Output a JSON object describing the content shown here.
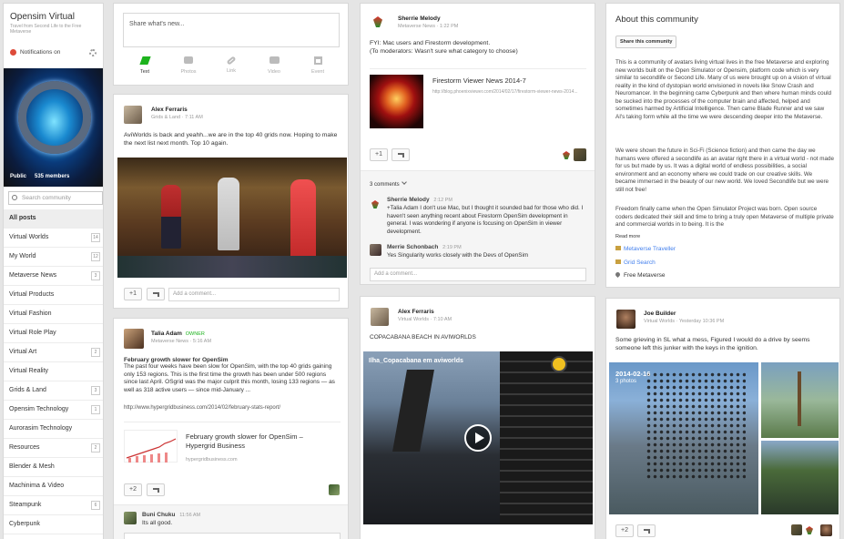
{
  "sidebar": {
    "title": "Opensim Virtual",
    "subtitle": "Travel from Second Life to the Free Metaverse",
    "notifications_label": "Notifications on",
    "visibility": "Public",
    "members": "535 members",
    "search_placeholder": "Search community",
    "items": [
      {
        "label": "All posts",
        "count": ""
      },
      {
        "label": "Virtual Worlds",
        "count": "14"
      },
      {
        "label": "My World",
        "count": "12"
      },
      {
        "label": "Metaverse News",
        "count": "3"
      },
      {
        "label": "Virtual Products",
        "count": ""
      },
      {
        "label": "Virtual Fashion",
        "count": ""
      },
      {
        "label": "Virtual Role Play",
        "count": ""
      },
      {
        "label": "Virtual Art",
        "count": "2"
      },
      {
        "label": "Virtual Reality",
        "count": ""
      },
      {
        "label": "Grids & Land",
        "count": "3"
      },
      {
        "label": "Opensim Technology",
        "count": "1"
      },
      {
        "label": "Aurorasim Technology",
        "count": ""
      },
      {
        "label": "Resources",
        "count": "2"
      },
      {
        "label": "Blender & Mesh",
        "count": ""
      },
      {
        "label": "Machinima & Video",
        "count": ""
      },
      {
        "label": "Steampunk",
        "count": "6"
      },
      {
        "label": "Cyberpunk",
        "count": ""
      }
    ]
  },
  "composer": {
    "placeholder": "Share what's new...",
    "actions": [
      "Text",
      "Photos",
      "Link",
      "Video",
      "Event"
    ]
  },
  "post_alex": {
    "author": "Alex Ferraris",
    "category": "Grids & Land",
    "time": "7:11 AM",
    "text": "AviWorlds is back and yeahh...we are in the top 40 grids now. Hoping to make the next list next month. Top 10 again.",
    "plus": "+1",
    "add_comment": "Add a comment..."
  },
  "post_talia": {
    "author": "Talia Adam",
    "role": "OWNER",
    "category": "Metaverse News",
    "time": "5:16 AM",
    "headline": "February growth slower for OpenSim",
    "text": "The past four weeks have been slow for OpenSim, with the top 40 grids gaining only 153 regions. This is the first time the growth has been under 500 regions since last April. OSgrid was the major culprit this month, losing 133 regions — as well as 318 active users — since mid-January ...",
    "url": "http://www.hypergridbusiness.com/2014/02/february-stats-report/",
    "link_title": "February growth slower for OpenSim – Hypergrid Business",
    "link_domain": "hypergridbusiness.com",
    "plus": "+2"
  },
  "comment_buni": {
    "author": "Buni Chuku",
    "time": "11:56 AM",
    "text": "Its all good."
  },
  "post_sherrie": {
    "author": "Sherrie Melody",
    "category": "Metaverse News",
    "time": "1:22 PM",
    "text1": "FYI: Mac users and Firestorm development.",
    "text2": "(To moderators: Wasn't sure what category to choose)",
    "link_title": "Firestorm Viewer News 2014-7",
    "link_url": "http://blog.phoenixviewer.com/2014/02/17/firestorm-viewer-news-2014...",
    "plus": "+1",
    "comments_count": "3 comments",
    "c1_author": "Sherrie Melody",
    "c1_time": "2:12 PM",
    "c1_text": "+Talia Adam I don't use Mac, but I thought it sounded bad for those who did. I haven't seen anything recent about Firestorm OpenSim development in general. I was wondering if anyone is focusing on OpenSim in viewer development.",
    "c2_author": "Merrie Schonbach",
    "c2_time": "2:19 PM",
    "c2_text": "Yes Singularity works closely with the Devs of OpenSim",
    "add_comment": "Add a comment..."
  },
  "post_alex2": {
    "author": "Alex Ferraris",
    "category": "Virtual Worlds",
    "time": "7:10 AM",
    "text": "COPACABANA BEACH IN AVIWORLDS",
    "video_title": "Ilha_Copacabana em aviworlds"
  },
  "about": {
    "title": "About this community",
    "share_btn": "Share this community",
    "p1": "This is a community of avatars living virtual lives in the free Metaverse and exploring new worlds built on the Open Simulator or Opensim, platform code which is very similar to secondlife or Second Life. Many of us were brought up on a vision of virtual reality in the kind of dystopian world envisioned in novels like Snow Crash and Neuromancer. In the beginning came Cyberpunk and then where human minds could be sucked into the processes of the computer brain and affected, helped and sometimes harmed by Artificial Intelligence. Then came Blade Runner and we saw AI's taking form while all the time we were descending deeper into the Metaverse.",
    "p2": "We were shown the future in Sci-Fi (Science fiction) and then came the day we humans were offered a secondlife as an avatar right there in a virtual world - not made for us but made by us. It was a digital world of endless possibilities, a social environment and an economy where we could trade on our creative skills. We became immersed in the beauty of our new world. We loved Secondlife but we were still not free!",
    "p3": "Freedom finally came when the Open Simulator Project was born. Open source coders dedicated their skill and time to bring a truly open Metaverse of multiple private and commercial worlds in to being. It is the",
    "read_more": "Read more",
    "link1": "Metaverse Traveller",
    "link2": "Grid Search",
    "location": "Free Metaverse"
  },
  "post_joe": {
    "author": "Joe Builder",
    "category": "Virtual Worlds",
    "time": "Yesterday 10:36 PM",
    "text": "Some grieving in SL what a mess, Figured I would do a drive by seems someone left this junker with the keys in the ignition.",
    "album_date": "2014-02-16",
    "album_count": "3 photos",
    "plus": "+2"
  },
  "colors": {
    "accent": "#427fed",
    "owner": "#1db31d",
    "composer_active": "#1db31d"
  }
}
